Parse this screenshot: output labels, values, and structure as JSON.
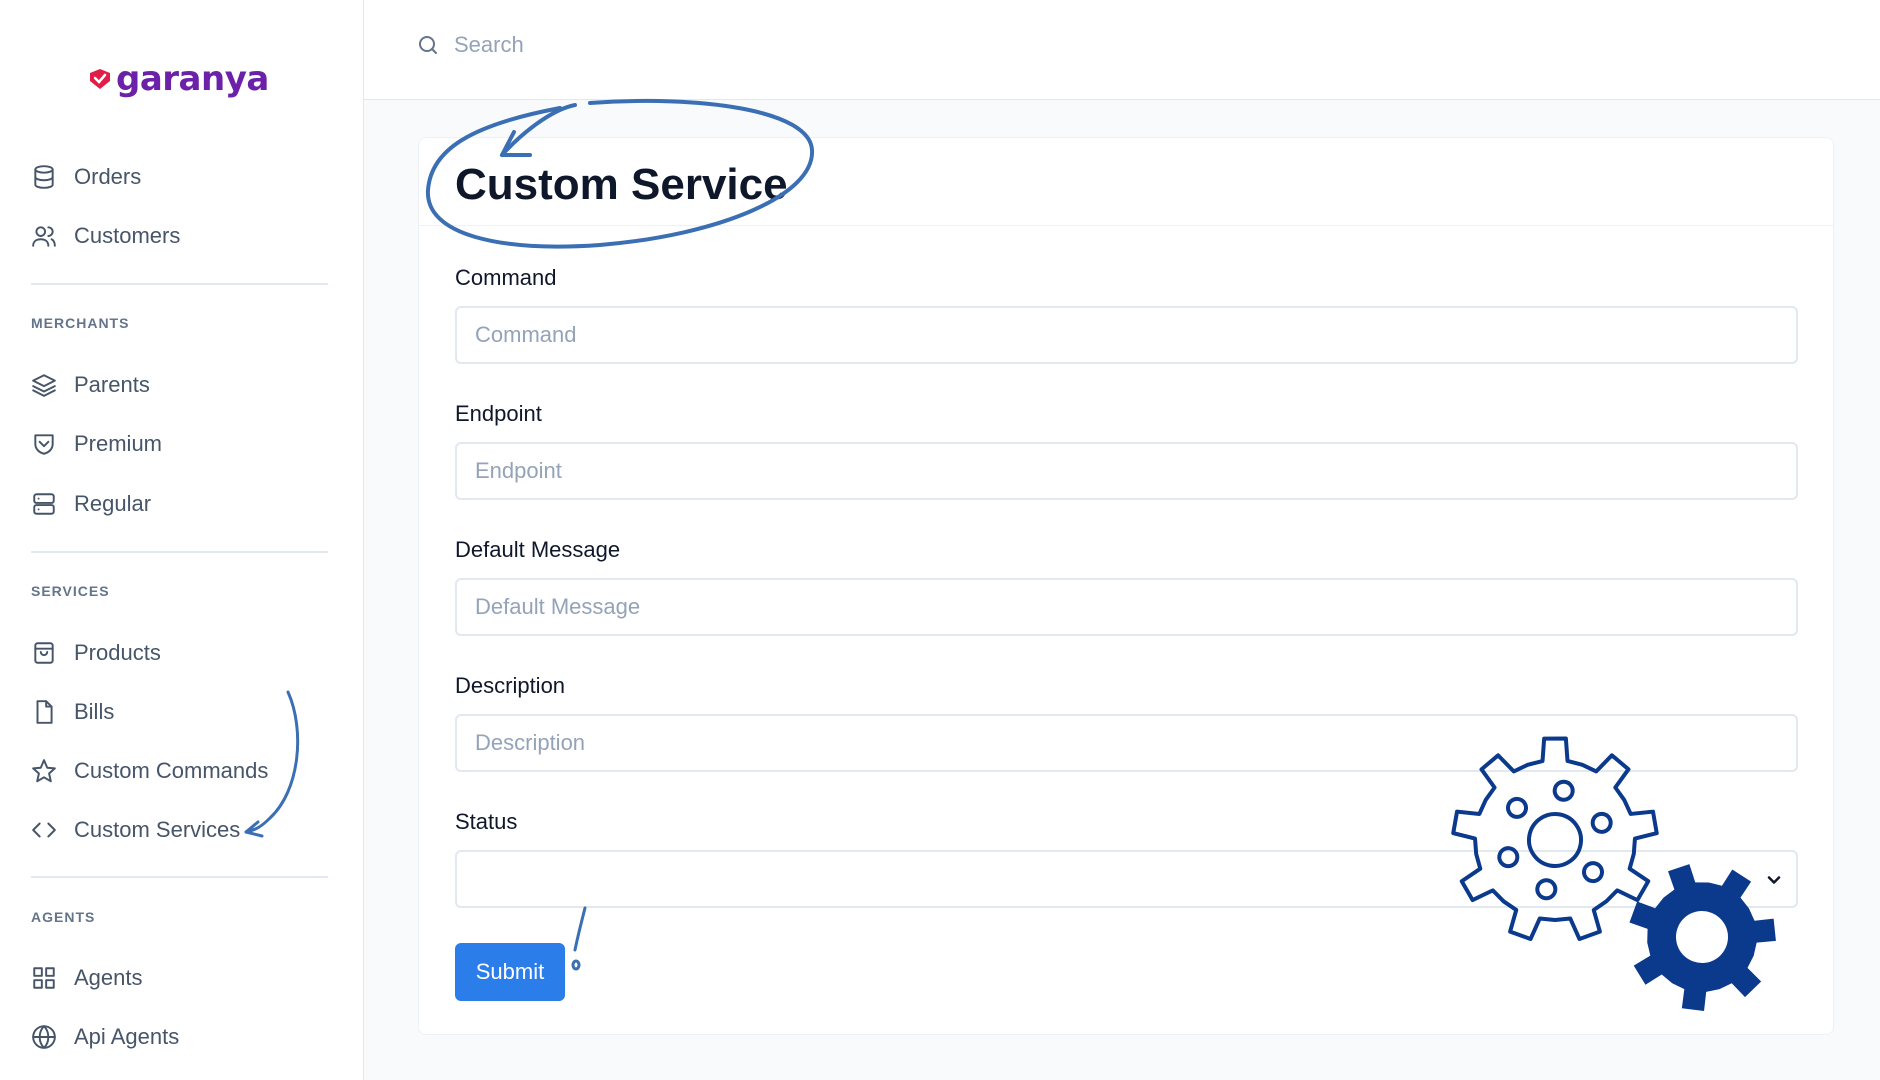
{
  "brand": {
    "name": "garanya"
  },
  "search": {
    "placeholder": "Search"
  },
  "sidebar": {
    "top_items": [
      {
        "label": "Orders",
        "icon": "database-icon"
      },
      {
        "label": "Customers",
        "icon": "users-icon"
      }
    ],
    "sections": [
      {
        "title": "MERCHANTS",
        "items": [
          {
            "label": "Parents",
            "icon": "layers-icon"
          },
          {
            "label": "Premium",
            "icon": "shield-icon"
          },
          {
            "label": "Regular",
            "icon": "server-icon"
          }
        ]
      },
      {
        "title": "SERVICES",
        "items": [
          {
            "label": "Products",
            "icon": "shopping-bag-icon"
          },
          {
            "label": "Bills",
            "icon": "file-icon"
          },
          {
            "label": "Custom Commands",
            "icon": "star-icon"
          },
          {
            "label": "Custom Services",
            "icon": "code-icon"
          }
        ]
      },
      {
        "title": "AGENTS",
        "items": [
          {
            "label": "Agents",
            "icon": "grid-icon"
          },
          {
            "label": "Api Agents",
            "icon": "globe-icon"
          }
        ]
      }
    ]
  },
  "form": {
    "title": "Custom Service",
    "fields": [
      {
        "label": "Command",
        "placeholder": "Command"
      },
      {
        "label": "Endpoint",
        "placeholder": "Endpoint"
      },
      {
        "label": "Default Message",
        "placeholder": "Default Message"
      },
      {
        "label": "Description",
        "placeholder": "Description"
      }
    ],
    "status": {
      "label": "Status",
      "value": ""
    },
    "submit_label": "Submit"
  },
  "colors": {
    "accent": "#2b7de9",
    "annotation": "#3b6fb4",
    "gear": "#0b3a8c",
    "brand": "#6b21a8",
    "brand_red": "#e11d48"
  }
}
